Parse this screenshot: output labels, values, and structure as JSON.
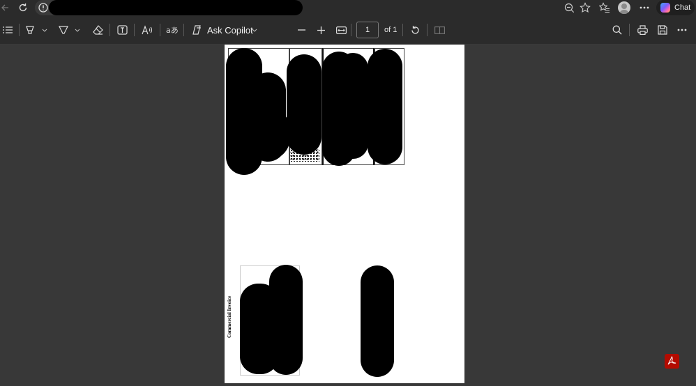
{
  "browser": {
    "back_icon": "back-arrow-icon",
    "refresh_icon": "refresh-icon",
    "site_info_icon": "info-icon",
    "zoom_icon": "zoom-out-icon",
    "favorite_icon": "star-icon",
    "favorites_icon": "favorites-icon",
    "more_icon": "more-icon",
    "chat_label": "Chat"
  },
  "pdf_toolbar": {
    "copilot_label": "Ask Copilot",
    "page_number": "1",
    "page_count": "of 1"
  },
  "document": {
    "vertical_label": "Commercial Invoice"
  },
  "colors": {
    "toolbar_bg": "#2b2b2b",
    "canvas_bg": "#383838",
    "pdf_logo": "#b30b00"
  }
}
